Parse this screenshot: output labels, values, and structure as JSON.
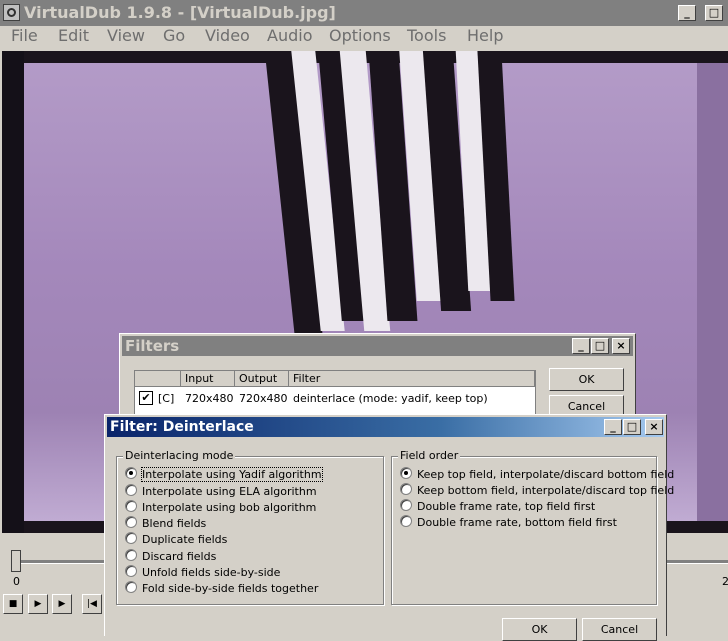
{
  "window": {
    "title": "VirtualDub 1.9.8 - [VirtualDub.jpg]",
    "controls": {
      "minimize": "_",
      "maximize": "□",
      "close": "×"
    }
  },
  "menu": [
    {
      "label": "File"
    },
    {
      "label": "Edit"
    },
    {
      "label": "View"
    },
    {
      "label": "Go"
    },
    {
      "label": "Video"
    },
    {
      "label": "Audio"
    },
    {
      "label": "Options"
    },
    {
      "label": "Tools"
    },
    {
      "label": "Help"
    }
  ],
  "timeline": {
    "start": "0",
    "end": "2"
  },
  "filters_dialog": {
    "title": "Filters",
    "columns": [
      "",
      "Input",
      "Output",
      "Filter"
    ],
    "rows": [
      {
        "enabled": true,
        "flag": "[C]",
        "input": "720x480",
        "output": "720x480",
        "filter": "deinterlace (mode: yadif, keep top)"
      }
    ],
    "ok_label": "OK",
    "cancel_label": "Cancel"
  },
  "deinterlace_dialog": {
    "title": "Filter: Deinterlace",
    "mode_group": "Deinterlacing mode",
    "modes": [
      {
        "label": "Interpolate using Yadif algorithm",
        "selected": true
      },
      {
        "label": "Interpolate using ELA algorithm",
        "selected": false
      },
      {
        "label": "Interpolate using bob algorithm",
        "selected": false
      },
      {
        "label": "Blend fields",
        "selected": false
      },
      {
        "label": "Duplicate fields",
        "selected": false
      },
      {
        "label": "Discard fields",
        "selected": false
      },
      {
        "label": "Unfold fields side-by-side",
        "selected": false
      },
      {
        "label": "Fold side-by-side fields together",
        "selected": false
      }
    ],
    "field_group": "Field order",
    "field_orders": [
      {
        "label": "Keep top field, interpolate/discard bottom field",
        "selected": true
      },
      {
        "label": "Keep bottom field, interpolate/discard top field",
        "selected": false
      },
      {
        "label": "Double frame rate, top field first",
        "selected": false
      },
      {
        "label": "Double frame rate, bottom field first",
        "selected": false
      }
    ],
    "ok_label": "OK",
    "cancel_label": "Cancel"
  }
}
